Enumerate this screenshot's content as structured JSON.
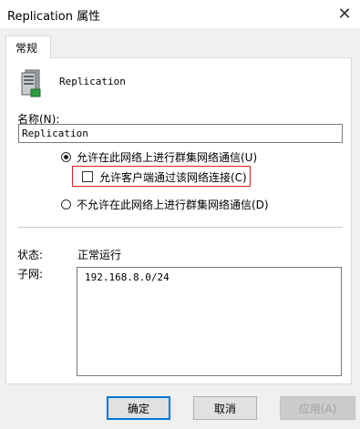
{
  "window": {
    "title": "Replication 属性",
    "close_glyph": "✕"
  },
  "tabs": [
    {
      "label": "常规",
      "selected": true
    }
  ],
  "resource": {
    "icon": "server-icon",
    "name": "Replication"
  },
  "name_field": {
    "label": "名称(N):",
    "value": "Replication"
  },
  "network_options": {
    "allow_cluster": {
      "label": "允许在此网络上进行群集网络通信(U)",
      "checked": true
    },
    "allow_clients": {
      "label": "允许客户端通过该网络连接(C)",
      "checked": false
    },
    "disallow_cluster": {
      "label": "不允许在此网络上进行群集网络通信(D)",
      "checked": false
    }
  },
  "status": {
    "label": "状态:",
    "value": "正常运行"
  },
  "subnet": {
    "label": "子网:",
    "value": "192.168.8.0/24"
  },
  "buttons": {
    "ok": "确定",
    "cancel": "取消",
    "apply": "应用(A)"
  },
  "colors": {
    "highlight": "#e02020",
    "focus": "#0078d7"
  }
}
